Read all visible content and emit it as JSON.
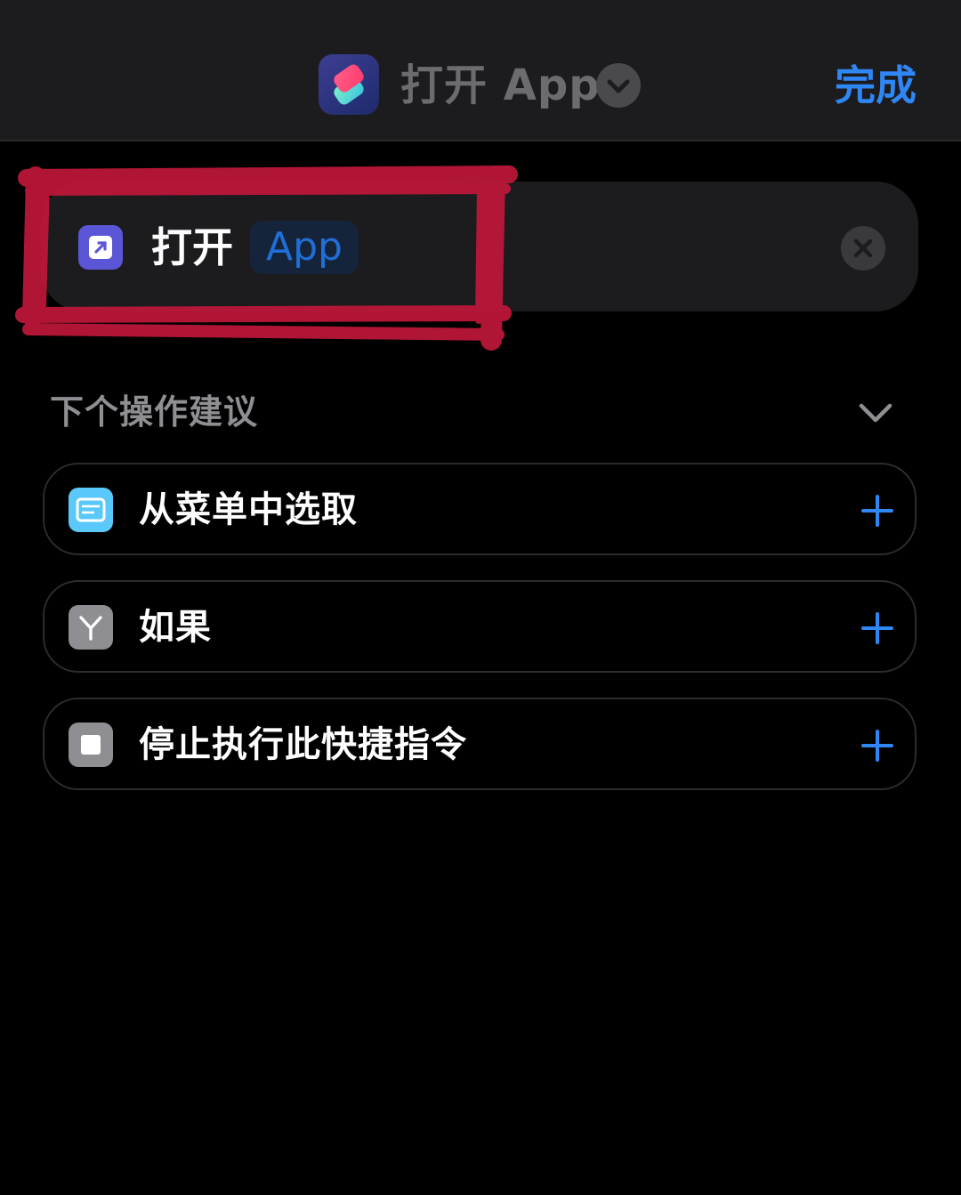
{
  "topbar": {
    "app_icon": "shortcuts-app-icon",
    "title": "打开 App",
    "chevron_icon": "chevron-down-icon",
    "done_label": "完成"
  },
  "action": {
    "icon": "open-app-icon",
    "label": "打开",
    "parameter": "App",
    "remove_icon": "close-icon",
    "highlighted": true,
    "highlight_color": "#c0173a"
  },
  "suggestions": {
    "title": "下个操作建议",
    "collapse_icon": "chevron-down-icon",
    "items": [
      {
        "label": "从菜单中选取",
        "icon": "menu-icon",
        "icon_color": "#5ac8fa"
      },
      {
        "label": "如果",
        "icon": "branch-icon",
        "icon_color": "#8e8e93"
      },
      {
        "label": "停止执行此快捷指令",
        "icon": "stop-icon",
        "icon_color": "#8e8e93"
      }
    ],
    "add_icon": "plus-icon"
  },
  "colors": {
    "accent": "#2f86f5",
    "background": "#000000",
    "card": "#1c1c1e"
  }
}
